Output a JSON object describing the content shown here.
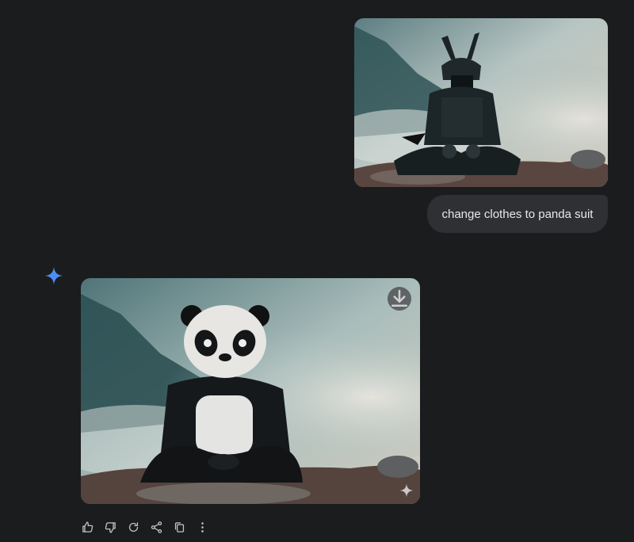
{
  "conversation": {
    "user_message": {
      "image_alt": "",
      "text": "change clothes to panda suit"
    },
    "model_response": {
      "image_alt": ""
    }
  },
  "icons": {
    "model_logo": "sparkle-icon",
    "download": "download-icon",
    "corner_mark": "sparkle-icon",
    "actions": [
      "thumbs-up-icon",
      "thumbs-down-icon",
      "regenerate-icon",
      "share-icon",
      "copy-icon",
      "more-vertical-icon"
    ]
  },
  "colors": {
    "background": "#1b1c1e",
    "bubble": "#2f3033",
    "accent_blue": "#4c8df6",
    "icon": "#c4c7c5"
  }
}
